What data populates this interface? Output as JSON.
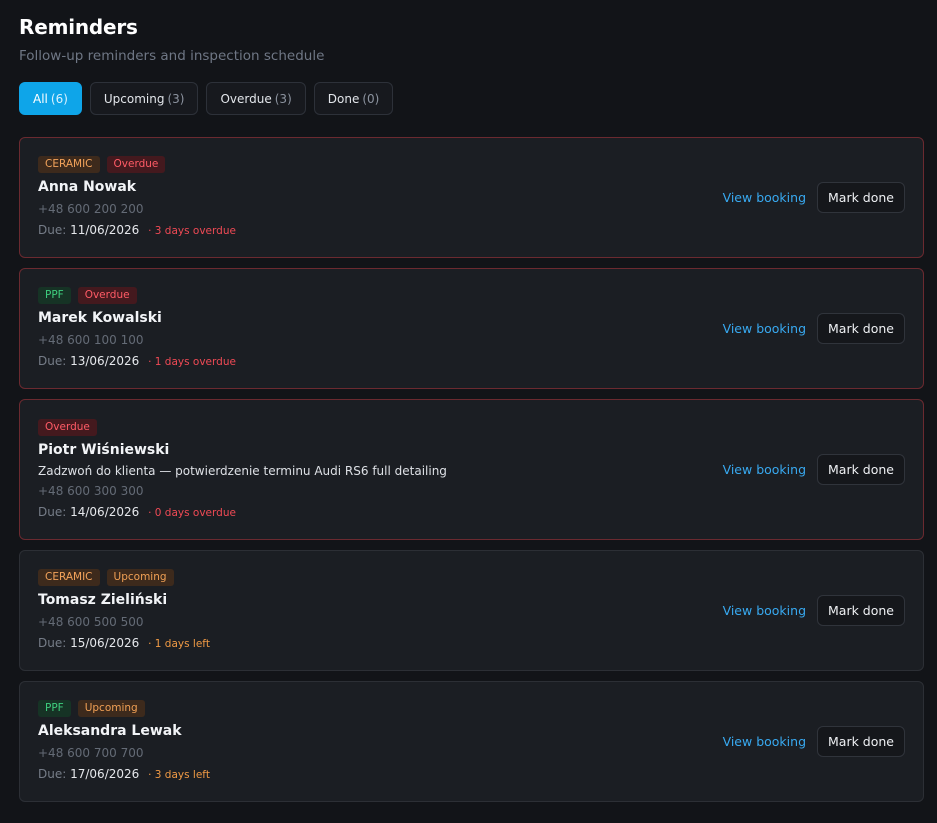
{
  "header": {
    "title": "Reminders",
    "subtitle": "Follow-up reminders and inspection schedule"
  },
  "filters": [
    {
      "label": "All",
      "count": "(6)",
      "active": true
    },
    {
      "label": "Upcoming",
      "count": "(3)"
    },
    {
      "label": "Overdue",
      "count": "(3)"
    },
    {
      "label": "Done",
      "count": "(0)"
    }
  ],
  "reminders": [
    {
      "tags": [
        {
          "label": "CERAMIC",
          "kind": "ceramic"
        },
        {
          "label": "Overdue",
          "kind": "overdue"
        }
      ],
      "name": "Anna Nowak",
      "note": "",
      "phone": "+48 600 200 200",
      "due_label": "Due:",
      "due_date": "11/06/2026",
      "delta": "· 3 days overdue",
      "status": "overdue",
      "view_label": "View booking",
      "done_label": "Mark done"
    },
    {
      "tags": [
        {
          "label": "PPF",
          "kind": "ppf"
        },
        {
          "label": "Overdue",
          "kind": "overdue"
        }
      ],
      "name": "Marek Kowalski",
      "note": "",
      "phone": "+48 600 100 100",
      "due_label": "Due:",
      "due_date": "13/06/2026",
      "delta": "· 1 days overdue",
      "status": "overdue",
      "view_label": "View booking",
      "done_label": "Mark done"
    },
    {
      "tags": [
        {
          "label": "Overdue",
          "kind": "overdue"
        }
      ],
      "name": "Piotr Wiśniewski",
      "note": "Zadzwoń do klienta — potwierdzenie terminu Audi RS6 full detailing",
      "phone": "+48 600 300 300",
      "due_label": "Due:",
      "due_date": "14/06/2026",
      "delta": "· 0 days overdue",
      "status": "overdue",
      "view_label": "View booking",
      "done_label": "Mark done"
    },
    {
      "tags": [
        {
          "label": "CERAMIC",
          "kind": "ceramic"
        },
        {
          "label": "Upcoming",
          "kind": "upcoming"
        }
      ],
      "name": "Tomasz Zieliński",
      "note": "",
      "phone": "+48 600 500 500",
      "due_label": "Due:",
      "due_date": "15/06/2026",
      "delta": "· 1 days left",
      "status": "upcoming",
      "view_label": "View booking",
      "done_label": "Mark done"
    },
    {
      "tags": [
        {
          "label": "PPF",
          "kind": "ppf"
        },
        {
          "label": "Upcoming",
          "kind": "upcoming"
        }
      ],
      "name": "Aleksandra Lewak",
      "note": "",
      "phone": "+48 600 700 700",
      "due_label": "Due:",
      "due_date": "17/06/2026",
      "delta": "· 3 days left",
      "status": "upcoming",
      "view_label": "View booking",
      "done_label": "Mark done"
    }
  ],
  "colors": {
    "accent": "#0ea5e9",
    "overdue": "#f04a55",
    "upcoming": "#f09a45",
    "ppf": "#3ecf7e"
  }
}
